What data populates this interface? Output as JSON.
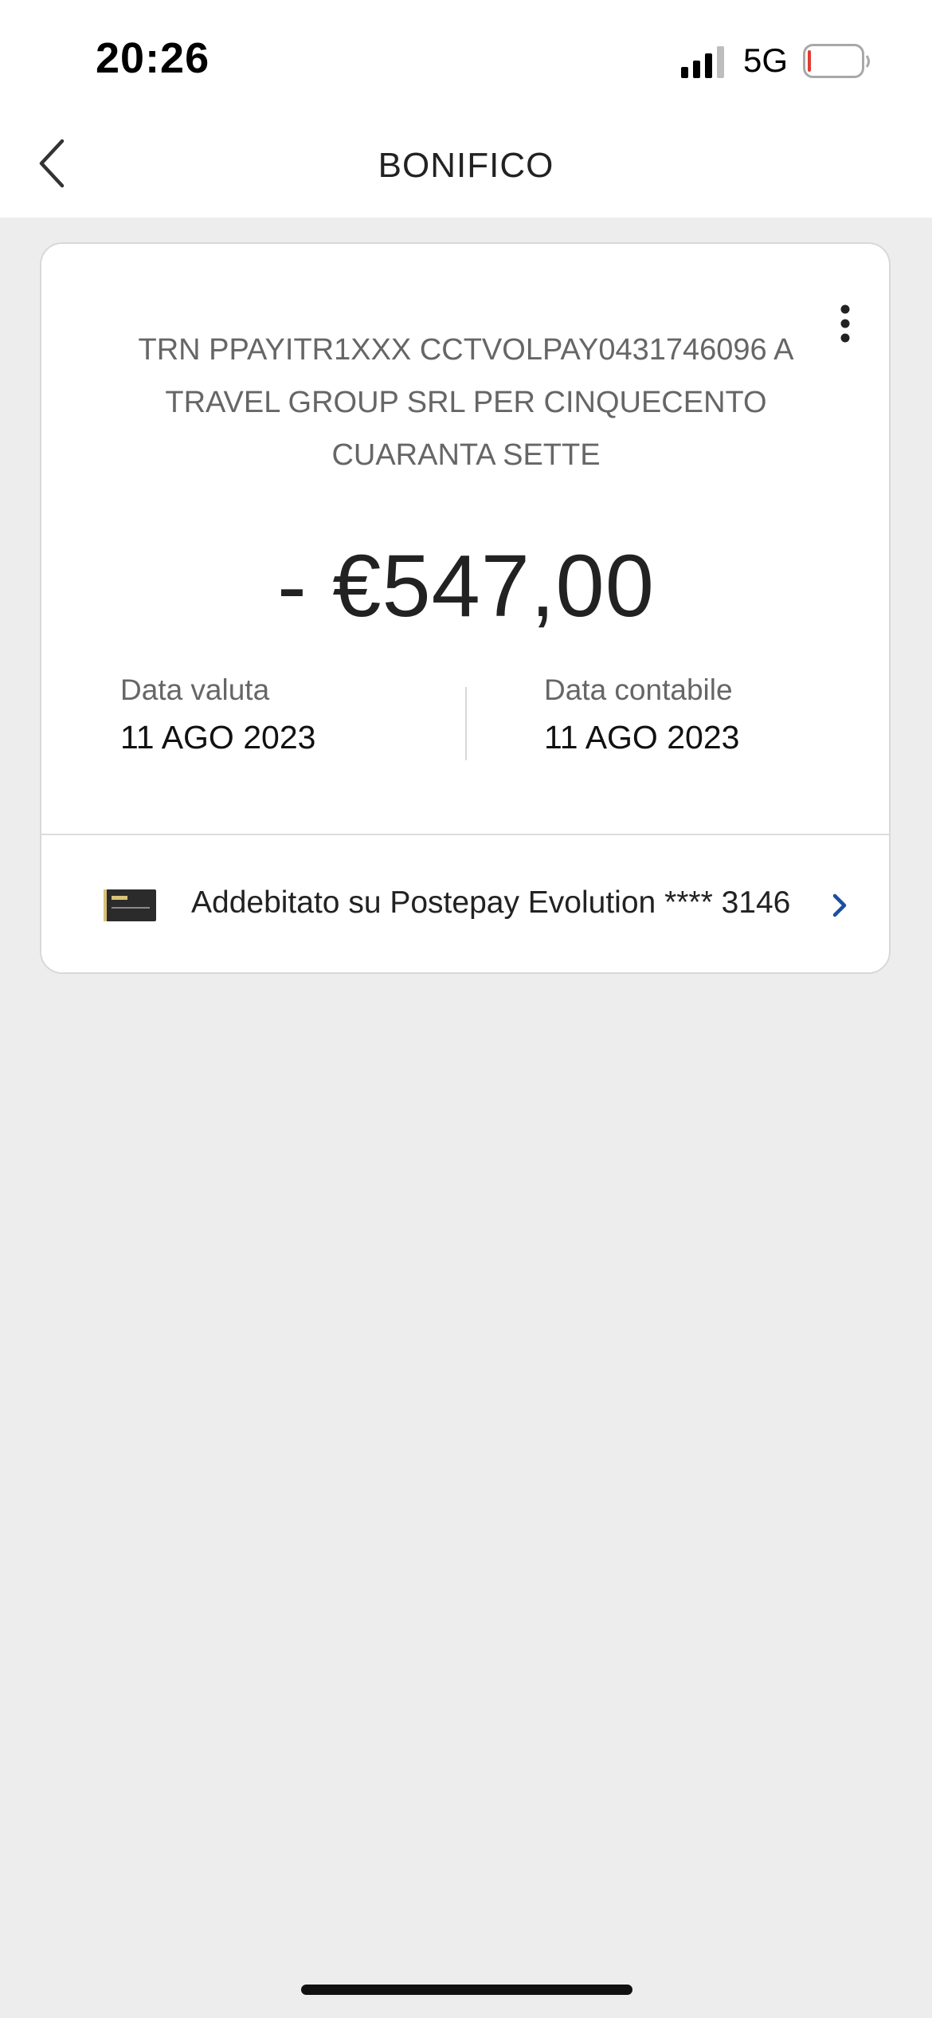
{
  "status_bar": {
    "time": "20:26",
    "network": "5G",
    "signal_icon": "cellular-signal-icon",
    "battery_icon": "battery-low-icon"
  },
  "nav": {
    "title": "BONIFICO",
    "back_icon": "chevron-left-icon"
  },
  "transaction": {
    "description": "TRN PPAYITR1XXX CCTVOLPAY0431746096 A TRAVEL GROUP SRL PER CINQUECENTO CUARANTA SETTE",
    "amount": "- €547,00",
    "more_icon": "more-vertical-icon",
    "value_date": {
      "label": "Data valuta",
      "value": "11 AGO 2023"
    },
    "booking_date": {
      "label": "Data contabile",
      "value": "11 AGO 2023"
    }
  },
  "account": {
    "label": "Addebitato su Postepay Evolution **** 3146",
    "card_icon": "payment-card-icon",
    "chevron_icon": "chevron-right-icon"
  },
  "colors": {
    "accent": "#1a4fa0",
    "background": "#ededed",
    "card_gold": "#d8c27a",
    "battery_red": "#e03c31"
  }
}
